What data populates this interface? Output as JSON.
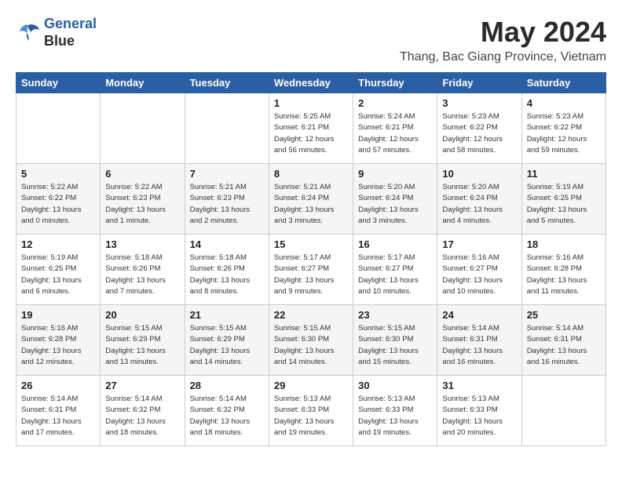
{
  "header": {
    "logo_line1": "General",
    "logo_line2": "Blue",
    "month_year": "May 2024",
    "location": "Thang, Bac Giang Province, Vietnam"
  },
  "weekdays": [
    "Sunday",
    "Monday",
    "Tuesday",
    "Wednesday",
    "Thursday",
    "Friday",
    "Saturday"
  ],
  "weeks": [
    [
      {
        "day": "",
        "sunrise": "",
        "sunset": "",
        "daylight": ""
      },
      {
        "day": "",
        "sunrise": "",
        "sunset": "",
        "daylight": ""
      },
      {
        "day": "",
        "sunrise": "",
        "sunset": "",
        "daylight": ""
      },
      {
        "day": "1",
        "sunrise": "Sunrise: 5:25 AM",
        "sunset": "Sunset: 6:21 PM",
        "daylight": "Daylight: 12 hours and 56 minutes."
      },
      {
        "day": "2",
        "sunrise": "Sunrise: 5:24 AM",
        "sunset": "Sunset: 6:21 PM",
        "daylight": "Daylight: 12 hours and 57 minutes."
      },
      {
        "day": "3",
        "sunrise": "Sunrise: 5:23 AM",
        "sunset": "Sunset: 6:22 PM",
        "daylight": "Daylight: 12 hours and 58 minutes."
      },
      {
        "day": "4",
        "sunrise": "Sunrise: 5:23 AM",
        "sunset": "Sunset: 6:22 PM",
        "daylight": "Daylight: 12 hours and 59 minutes."
      }
    ],
    [
      {
        "day": "5",
        "sunrise": "Sunrise: 5:22 AM",
        "sunset": "Sunset: 6:22 PM",
        "daylight": "Daylight: 13 hours and 0 minutes."
      },
      {
        "day": "6",
        "sunrise": "Sunrise: 5:22 AM",
        "sunset": "Sunset: 6:23 PM",
        "daylight": "Daylight: 13 hours and 1 minute."
      },
      {
        "day": "7",
        "sunrise": "Sunrise: 5:21 AM",
        "sunset": "Sunset: 6:23 PM",
        "daylight": "Daylight: 13 hours and 2 minutes."
      },
      {
        "day": "8",
        "sunrise": "Sunrise: 5:21 AM",
        "sunset": "Sunset: 6:24 PM",
        "daylight": "Daylight: 13 hours and 3 minutes."
      },
      {
        "day": "9",
        "sunrise": "Sunrise: 5:20 AM",
        "sunset": "Sunset: 6:24 PM",
        "daylight": "Daylight: 13 hours and 3 minutes."
      },
      {
        "day": "10",
        "sunrise": "Sunrise: 5:20 AM",
        "sunset": "Sunset: 6:24 PM",
        "daylight": "Daylight: 13 hours and 4 minutes."
      },
      {
        "day": "11",
        "sunrise": "Sunrise: 5:19 AM",
        "sunset": "Sunset: 6:25 PM",
        "daylight": "Daylight: 13 hours and 5 minutes."
      }
    ],
    [
      {
        "day": "12",
        "sunrise": "Sunrise: 5:19 AM",
        "sunset": "Sunset: 6:25 PM",
        "daylight": "Daylight: 13 hours and 6 minutes."
      },
      {
        "day": "13",
        "sunrise": "Sunrise: 5:18 AM",
        "sunset": "Sunset: 6:26 PM",
        "daylight": "Daylight: 13 hours and 7 minutes."
      },
      {
        "day": "14",
        "sunrise": "Sunrise: 5:18 AM",
        "sunset": "Sunset: 6:26 PM",
        "daylight": "Daylight: 13 hours and 8 minutes."
      },
      {
        "day": "15",
        "sunrise": "Sunrise: 5:17 AM",
        "sunset": "Sunset: 6:27 PM",
        "daylight": "Daylight: 13 hours and 9 minutes."
      },
      {
        "day": "16",
        "sunrise": "Sunrise: 5:17 AM",
        "sunset": "Sunset: 6:27 PM",
        "daylight": "Daylight: 13 hours and 10 minutes."
      },
      {
        "day": "17",
        "sunrise": "Sunrise: 5:16 AM",
        "sunset": "Sunset: 6:27 PM",
        "daylight": "Daylight: 13 hours and 10 minutes."
      },
      {
        "day": "18",
        "sunrise": "Sunrise: 5:16 AM",
        "sunset": "Sunset: 6:28 PM",
        "daylight": "Daylight: 13 hours and 11 minutes."
      }
    ],
    [
      {
        "day": "19",
        "sunrise": "Sunrise: 5:16 AM",
        "sunset": "Sunset: 6:28 PM",
        "daylight": "Daylight: 13 hours and 12 minutes."
      },
      {
        "day": "20",
        "sunrise": "Sunrise: 5:15 AM",
        "sunset": "Sunset: 6:29 PM",
        "daylight": "Daylight: 13 hours and 13 minutes."
      },
      {
        "day": "21",
        "sunrise": "Sunrise: 5:15 AM",
        "sunset": "Sunset: 6:29 PM",
        "daylight": "Daylight: 13 hours and 14 minutes."
      },
      {
        "day": "22",
        "sunrise": "Sunrise: 5:15 AM",
        "sunset": "Sunset: 6:30 PM",
        "daylight": "Daylight: 13 hours and 14 minutes."
      },
      {
        "day": "23",
        "sunrise": "Sunrise: 5:15 AM",
        "sunset": "Sunset: 6:30 PM",
        "daylight": "Daylight: 13 hours and 15 minutes."
      },
      {
        "day": "24",
        "sunrise": "Sunrise: 5:14 AM",
        "sunset": "Sunset: 6:31 PM",
        "daylight": "Daylight: 13 hours and 16 minutes."
      },
      {
        "day": "25",
        "sunrise": "Sunrise: 5:14 AM",
        "sunset": "Sunset: 6:31 PM",
        "daylight": "Daylight: 13 hours and 16 minutes."
      }
    ],
    [
      {
        "day": "26",
        "sunrise": "Sunrise: 5:14 AM",
        "sunset": "Sunset: 6:31 PM",
        "daylight": "Daylight: 13 hours and 17 minutes."
      },
      {
        "day": "27",
        "sunrise": "Sunrise: 5:14 AM",
        "sunset": "Sunset: 6:32 PM",
        "daylight": "Daylight: 13 hours and 18 minutes."
      },
      {
        "day": "28",
        "sunrise": "Sunrise: 5:14 AM",
        "sunset": "Sunset: 6:32 PM",
        "daylight": "Daylight: 13 hours and 18 minutes."
      },
      {
        "day": "29",
        "sunrise": "Sunrise: 5:13 AM",
        "sunset": "Sunset: 6:33 PM",
        "daylight": "Daylight: 13 hours and 19 minutes."
      },
      {
        "day": "30",
        "sunrise": "Sunrise: 5:13 AM",
        "sunset": "Sunset: 6:33 PM",
        "daylight": "Daylight: 13 hours and 19 minutes."
      },
      {
        "day": "31",
        "sunrise": "Sunrise: 5:13 AM",
        "sunset": "Sunset: 6:33 PM",
        "daylight": "Daylight: 13 hours and 20 minutes."
      },
      {
        "day": "",
        "sunrise": "",
        "sunset": "",
        "daylight": ""
      }
    ]
  ]
}
